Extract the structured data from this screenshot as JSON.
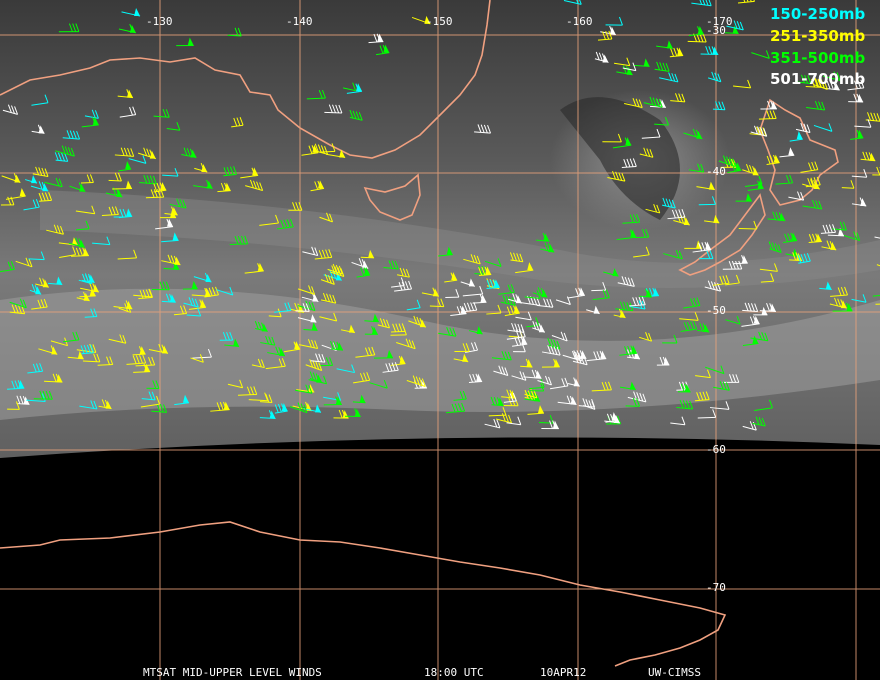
{
  "colors": {
    "grid": "#e8a27a",
    "coast": "#f0a080",
    "background_space": "#000000",
    "cloud_dark": "#4a4a4a",
    "cloud_light": "#a9a9a9"
  },
  "longitude_labels": [
    "-130",
    "-140",
    "-150",
    "-160",
    "-170"
  ],
  "latitude_labels": [
    "-30",
    "-40",
    "-50",
    "-60",
    "-70"
  ],
  "legend": [
    {
      "label": "150-250mb",
      "color": "#00ffff"
    },
    {
      "label": "251-350mb",
      "color": "#ffff00"
    },
    {
      "label": "351-500mb",
      "color": "#00ff00"
    },
    {
      "label": "501-700mb",
      "color": "#ffffff"
    }
  ],
  "footer": {
    "product": "MTSAT MID-UPPER LEVEL WINDS",
    "time": "18:00 UTC",
    "date": "10APR12",
    "source": "UW-CIMSS"
  }
}
